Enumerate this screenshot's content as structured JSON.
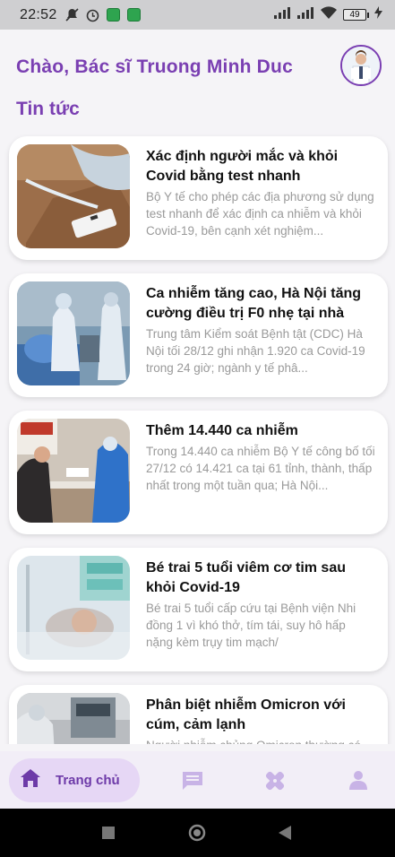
{
  "status_bar": {
    "time": "22:52",
    "battery": "49"
  },
  "header": {
    "greeting": "Chào, Bác sĩ Truong Minh Duc",
    "section_title": "Tin tức"
  },
  "news": [
    {
      "title": "Xác định người mắc và khỏi Covid bằng test nhanh",
      "description": "Bộ Y tế cho phép các địa phương sử dụng test nhanh để xác định ca nhiễm và khỏi Covid-19, bên cạnh xét nghiệm..."
    },
    {
      "title": "Ca nhiễm tăng cao, Hà Nội tăng cường điều trị F0 nhẹ tại nhà",
      "description": "Trung tâm Kiểm soát Bệnh tật (CDC) Hà Nội tối 28/12 ghi nhận 1.920 ca Covid-19 trong 24 giờ; ngành y tế phâ..."
    },
    {
      "title": "Thêm 14.440 ca nhiễm",
      "description": "Trong 14.440 ca nhiễm Bộ Y tế công bố tối 27/12 có 14.421 ca tại 61 tỉnh, thành, thấp nhất trong một tuần qua; Hà Nội..."
    },
    {
      "title": "Bé trai 5 tuổi viêm cơ tim sau khỏi Covid-19",
      "description": "Bé trai 5 tuổi cấp cứu tại Bệnh viện Nhi đồng 1 vì khó thở, tím tái, suy hô hấp nặng kèm trụy tim mạch/"
    },
    {
      "title": "Phân biệt nhiễm Omicron với cúm, cảm lạnh",
      "description": "Người nhiễm chủng Omicron thường có..."
    }
  ],
  "bottom_nav": {
    "home_label": "Trang chủ",
    "items": [
      "home-icon",
      "chat-icon",
      "bandage-icon",
      "profile-icon"
    ]
  },
  "colors": {
    "accent": "#7a3fb2",
    "nav_active_bg": "#e6d7f5",
    "nav_icon_inactive": "#c8b3e6"
  }
}
